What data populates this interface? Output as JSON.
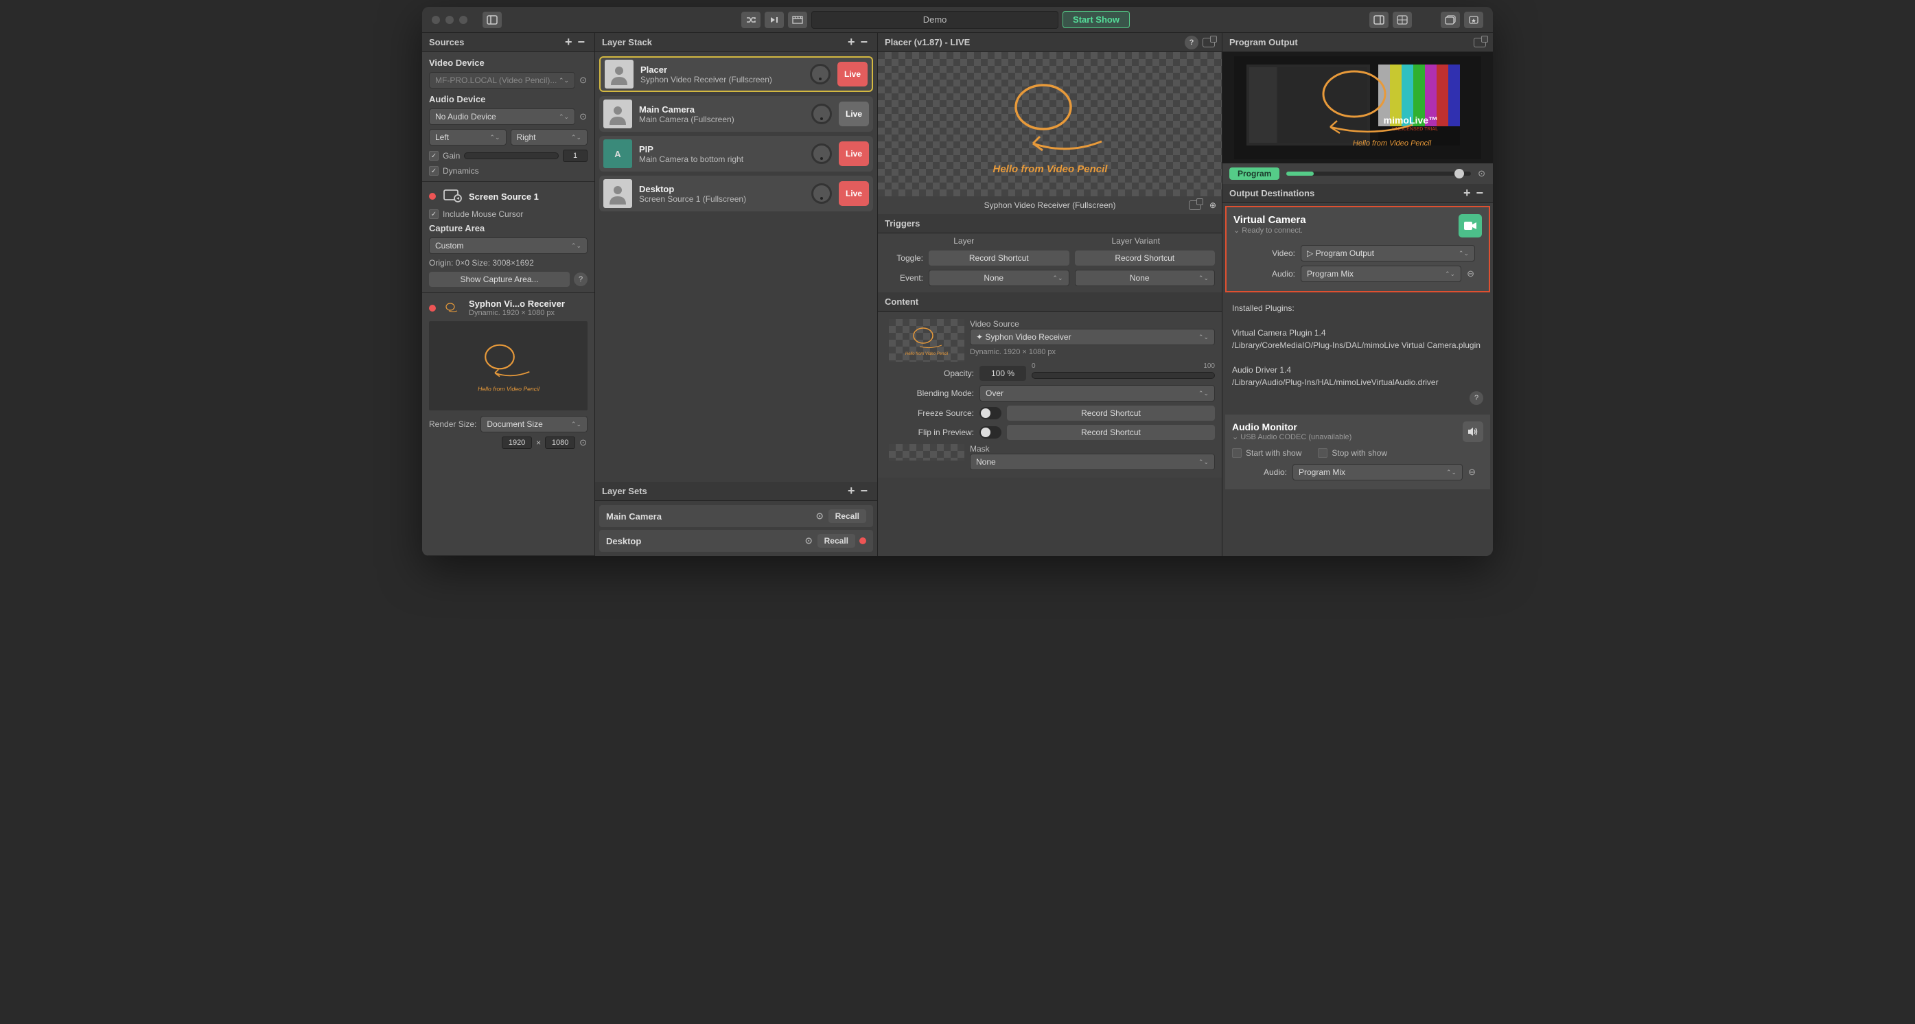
{
  "titlebar": {
    "title": "Demo",
    "start_show": "Start Show"
  },
  "sources": {
    "header": "Sources",
    "video_device": {
      "label": "Video Device",
      "value": "MF-PRO.LOCAL (Video Pencil)..."
    },
    "audio_device": {
      "label": "Audio Device",
      "value": "No Audio Device",
      "left": "Left",
      "right": "Right",
      "gain": "Gain",
      "gain_val": "1",
      "dynamics": "Dynamics"
    },
    "screen_source": {
      "title": "Screen Source 1",
      "include_cursor": "Include Mouse Cursor",
      "capture_area": "Capture Area",
      "capture_value": "Custom",
      "origin": "Origin: 0×0 Size: 3008×1692",
      "show_area": "Show Capture Area..."
    },
    "syphon": {
      "title": "Syphon Vi...o Receiver",
      "sub": "Dynamic. 1920 × 1080 px",
      "annotation": "Hello from Video Pencil",
      "render_size": "Render Size:",
      "render_value": "Document Size",
      "w": "1920",
      "h": "1080",
      "x": "×"
    }
  },
  "layer_stack": {
    "header": "Layer Stack",
    "layers": [
      {
        "title": "Placer",
        "sub": "Syphon Video Receiver (Fullscreen)",
        "live": "Live",
        "state": "red",
        "selected": true,
        "avatar": "person"
      },
      {
        "title": "Main Camera",
        "sub": "Main Camera (Fullscreen)",
        "live": "Live",
        "state": "gray",
        "avatar": "person"
      },
      {
        "title": "PIP",
        "sub": "Main Camera to bottom right",
        "live": "Live",
        "state": "red",
        "avatar": "A"
      },
      {
        "title": "Desktop",
        "sub": "Screen Source 1 (Fullscreen)",
        "live": "Live",
        "state": "red",
        "avatar": "person"
      }
    ],
    "layer_sets": {
      "header": "Layer Sets",
      "items": [
        {
          "name": "Main Camera",
          "recall": "Recall"
        },
        {
          "name": "Desktop",
          "recall": "Recall"
        }
      ]
    }
  },
  "placer": {
    "header": "Placer (v1.87) - LIVE",
    "preview_label": "Syphon Video Receiver (Fullscreen)",
    "annotation": "Hello from Video Pencil",
    "triggers": {
      "header": "Triggers",
      "col1": "Layer",
      "col2": "Layer Variant",
      "toggle": "Toggle:",
      "event": "Event:",
      "record": "Record Shortcut",
      "none": "None"
    },
    "content": {
      "header": "Content",
      "video_source": "Video Source",
      "video_value": "Syphon Video Receiver",
      "video_sub": "Dynamic. 1920 × 1080 px",
      "opacity": "Opacity:",
      "opacity_val": "100 %",
      "range_min": "0",
      "range_max": "100",
      "blending": "Blending Mode:",
      "blending_val": "Over",
      "freeze": "Freeze Source:",
      "flip": "Flip in Preview:",
      "record": "Record Shortcut",
      "mask": "Mask",
      "mask_val": "None"
    }
  },
  "output": {
    "header": "Program Output",
    "program": "Program",
    "annotation": "Hello from Video Pencil",
    "brand": "mimoLive™",
    "brand_sub": "UNLICENSED TRIAL",
    "dest_header": "Output Destinations",
    "vc": {
      "title": "Virtual Camera",
      "sub": "Ready to connect.",
      "video": "Video:",
      "video_val": "Program Output",
      "audio": "Audio:",
      "audio_val": "Program Mix"
    },
    "plugins": {
      "header": "Installed Plugins:",
      "p1a": "Virtual Camera Plugin 1.4",
      "p1b": "/Library/CoreMediaIO/Plug-Ins/DAL/mimoLive Virtual Camera.plugin",
      "p2a": "Audio Driver 1.4",
      "p2b": "/Library/Audio/Plug-Ins/HAL/mimoLiveVirtualAudio.driver"
    },
    "monitor": {
      "title": "Audio Monitor",
      "sub": "USB Audio CODEC  (unavailable)",
      "start": "Start with show",
      "stop": "Stop with show",
      "audio": "Audio:",
      "audio_val": "Program Mix"
    }
  }
}
